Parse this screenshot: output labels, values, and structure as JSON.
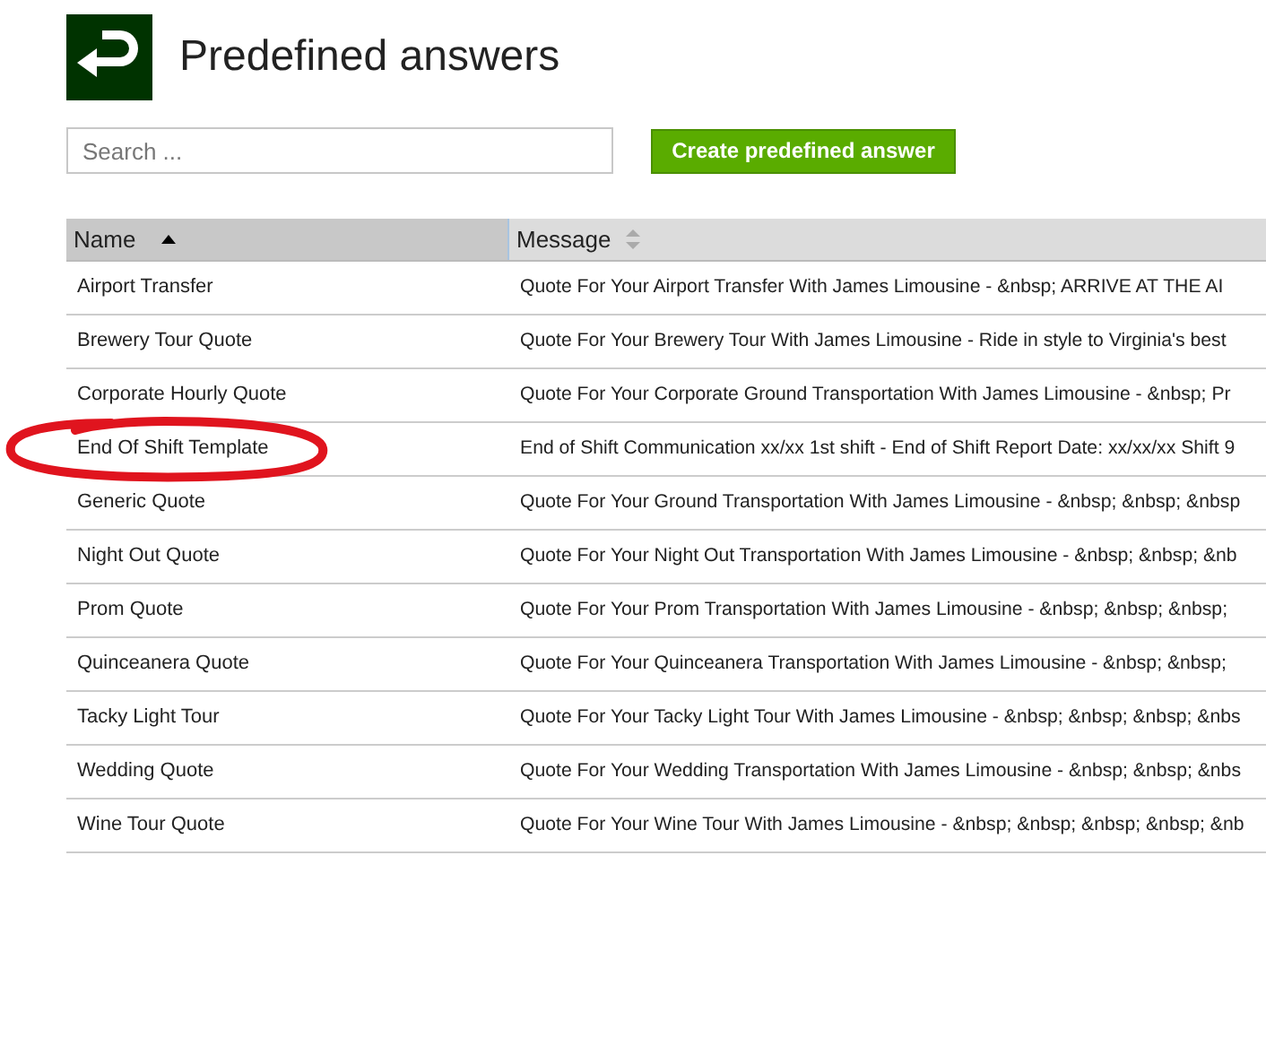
{
  "page": {
    "title": "Predefined answers"
  },
  "search": {
    "placeholder": "Search ..."
  },
  "create_button": "Create predefined answer",
  "table": {
    "columns": [
      {
        "label": "Name",
        "sorted": true
      },
      {
        "label": "Message",
        "sorted": false
      }
    ],
    "rows": [
      {
        "name": "Airport Transfer",
        "message": "Quote For Your Airport Transfer With James Limousine - &nbsp; ARRIVE AT THE AI",
        "circled": false
      },
      {
        "name": "Brewery Tour Quote",
        "message": "Quote For Your Brewery Tour With James Limousine - Ride in style to Virginia's best",
        "circled": false
      },
      {
        "name": "Corporate Hourly Quote",
        "message": "Quote For Your Corporate Ground Transportation With James Limousine - &nbsp; Pr",
        "circled": false
      },
      {
        "name": "End Of Shift Template",
        "message": "End of Shift Communication xx/xx 1st shift - End of Shift Report Date: xx/xx/xx Shift 9",
        "circled": true
      },
      {
        "name": "Generic Quote",
        "message": "Quote For Your Ground Transportation With James Limousine - &nbsp; &nbsp; &nbsp",
        "circled": false
      },
      {
        "name": "Night Out Quote",
        "message": "Quote For Your Night Out Transportation With James Limousine - &nbsp; &nbsp; &nb",
        "circled": false
      },
      {
        "name": "Prom Quote",
        "message": "Quote For Your Prom Transportation With James Limousine - &nbsp; &nbsp; &nbsp;",
        "circled": false
      },
      {
        "name": "Quinceanera Quote",
        "message": "Quote For Your Quinceanera Transportation With James Limousine - &nbsp; &nbsp;",
        "circled": false
      },
      {
        "name": "Tacky Light Tour",
        "message": "Quote For Your Tacky Light Tour With James Limousine - &nbsp; &nbsp; &nbsp; &nbs",
        "circled": false
      },
      {
        "name": "Wedding Quote",
        "message": "Quote For Your Wedding Transportation With James Limousine - &nbsp; &nbsp; &nbs",
        "circled": false
      },
      {
        "name": "Wine Tour Quote",
        "message": "Quote For Your Wine Tour With James Limousine - &nbsp; &nbsp; &nbsp; &nbsp; &nb",
        "circled": false
      }
    ]
  }
}
